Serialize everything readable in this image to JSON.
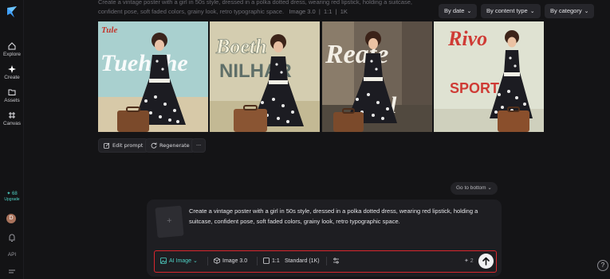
{
  "sidebar": {
    "items": [
      {
        "label": "Explore",
        "icon": "home-icon"
      },
      {
        "label": "Create",
        "icon": "sparkle-icon"
      },
      {
        "label": "Assets",
        "icon": "folder-icon"
      },
      {
        "label": "Canvas",
        "icon": "canvas-icon"
      }
    ],
    "credits": "✦ 68",
    "upgrade": "Upgrade",
    "avatar_initial": "D",
    "api_label": "API"
  },
  "result": {
    "prompt_text": "Create a vintage poster with a girl in 50s style, dressed in a polka dotted dress, wearing red lipstick, holding a suitcase, confident pose, soft faded colors, grainy look, retro typographic space.",
    "model": "Image 3.0",
    "ratio": "1:1",
    "resolution": "1K",
    "images": [
      {
        "poster_text": "Tule",
        "poster_text2": "Tueh the"
      },
      {
        "poster_text": "Boeth",
        "poster_text2": "NILHAR"
      },
      {
        "poster_text": "Reate",
        "poster_text2": "girl"
      },
      {
        "poster_text": "Rivo",
        "poster_text2": "SPORT"
      }
    ],
    "actions": {
      "edit": "Edit prompt",
      "regenerate": "Regenerate",
      "more": "···"
    }
  },
  "filters": {
    "date": "By date",
    "content_type": "By content type",
    "category": "By category"
  },
  "go_to_bottom": "Go to bottom",
  "composer": {
    "prompt": "Create a vintage poster with a girl in 50s style, dressed in a polka dotted dress, wearing red lipstick, holding a suitcase, confident pose, soft faded colors, grainy look, retro typographic space.",
    "attach_symbol": "+",
    "mode": "AI Image",
    "model": "Image 3.0",
    "ratio": "1:1",
    "quality": "Standard (1K)",
    "cost": "✦ 2"
  },
  "colors": {
    "accent": "#4fd1c5",
    "highlight_border": "#d9262e",
    "background": "#141416"
  }
}
